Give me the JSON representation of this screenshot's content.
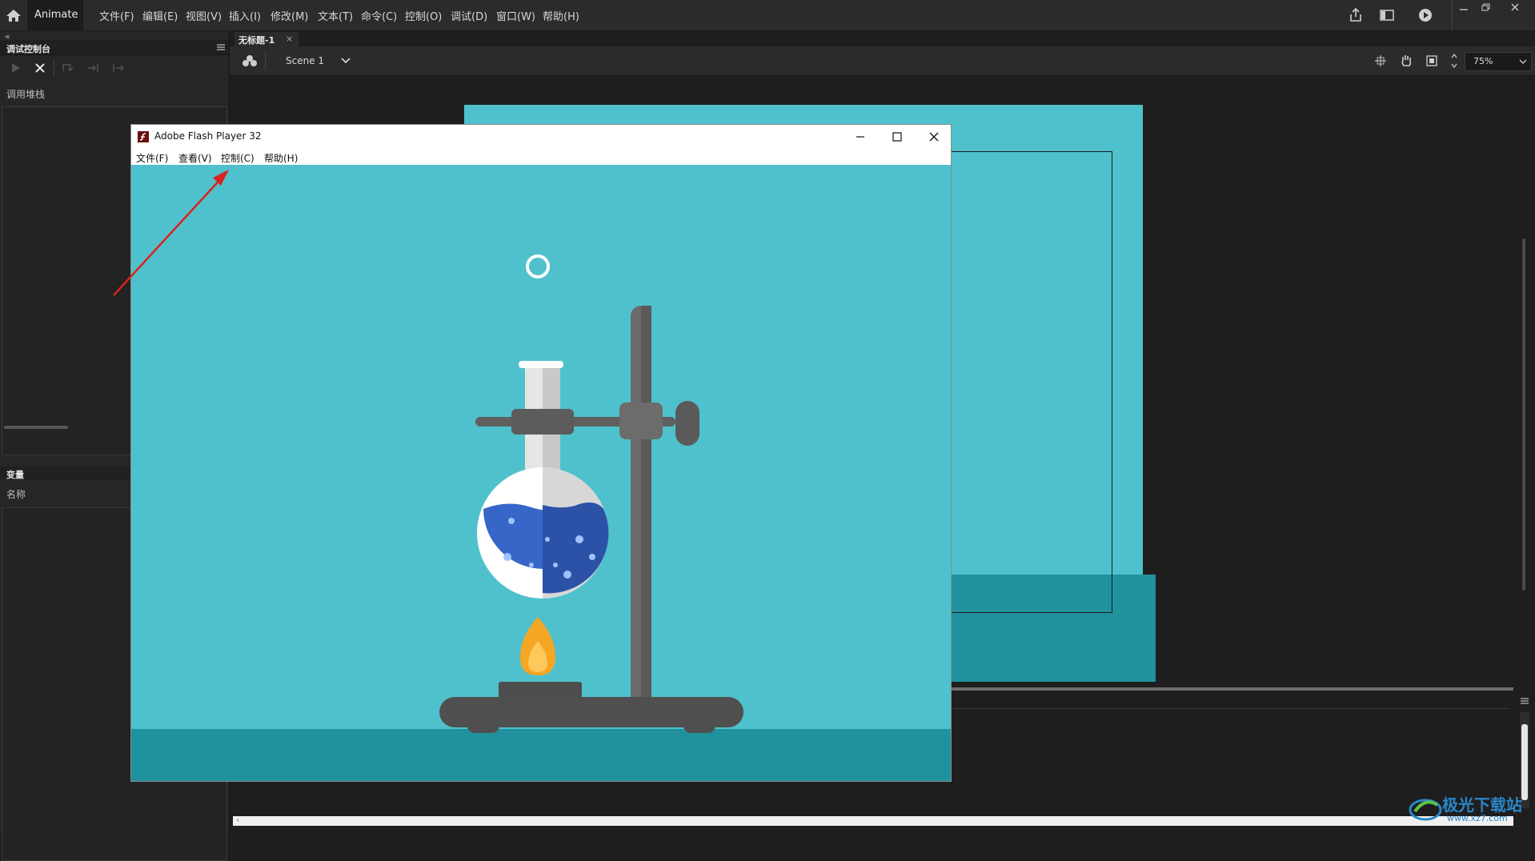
{
  "app": {
    "name": "Animate",
    "menus": [
      "文件(F)",
      "编辑(E)",
      "视图(V)",
      "插入(I)",
      "修改(M)",
      "文本(T)",
      "命令(C)",
      "控制(O)",
      "调试(D)",
      "窗口(W)",
      "帮助(H)"
    ]
  },
  "left_panel": {
    "collapse_glyph": "«",
    "debug_console_tab": "调试控制台",
    "call_stack_label": "调用堆栈",
    "variables_tab": "变量",
    "name_label": "名称"
  },
  "document": {
    "tab_label": "无标题-1",
    "tab_close": "×",
    "scene_label": "Scene 1",
    "zoom_value": "75%"
  },
  "flash_player": {
    "title": "Adobe Flash Player 32",
    "menus": [
      "文件(F)",
      "查看(V)",
      "控制(C)",
      "帮助(H)"
    ]
  },
  "watermark": {
    "text": "极光下载站",
    "url": "www.xz7.com"
  },
  "colors": {
    "stage_bg": "#4fc1cc",
    "stage_floor": "#20929e",
    "liquid": "#2f5bb8",
    "stand": "#5c5c5c",
    "flame": "#f5a623",
    "annotation_arrow": "#d9231c"
  },
  "icons": [
    "home-icon",
    "share-icon",
    "panel-icon",
    "play-icon",
    "minimize-icon",
    "restore-icon",
    "close-icon",
    "scene-icon",
    "chevron-down-icon",
    "center-icon",
    "hand-icon",
    "clip-icon"
  ]
}
